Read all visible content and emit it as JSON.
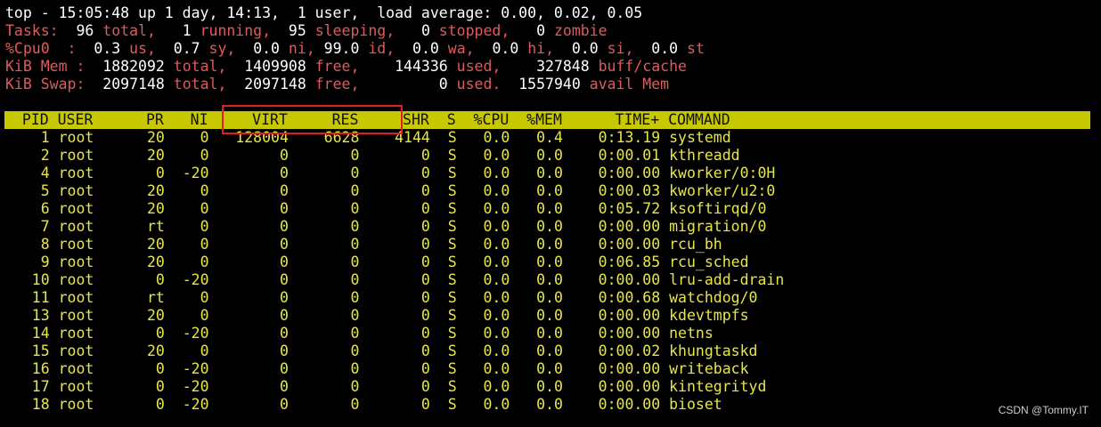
{
  "summary": {
    "line1": "top - 15:05:48 up 1 day, 14:13,  1 user,  load average: 0.00, 0.02, 0.05",
    "tasks": [
      {
        "t": "Tasks: ",
        "c": "lbl"
      },
      {
        "t": " 96",
        "c": "num"
      },
      {
        "t": " total,   ",
        "c": "lbl"
      },
      {
        "t": "1",
        "c": "num"
      },
      {
        "t": " running,  ",
        "c": "lbl"
      },
      {
        "t": "95",
        "c": "num"
      },
      {
        "t": " sleeping,   ",
        "c": "lbl"
      },
      {
        "t": "0",
        "c": "num"
      },
      {
        "t": " stopped,   ",
        "c": "lbl"
      },
      {
        "t": "0",
        "c": "num"
      },
      {
        "t": " zombie",
        "c": "lbl"
      }
    ],
    "cpu": [
      {
        "t": "%Cpu0  : ",
        "c": "lbl"
      },
      {
        "t": " 0.3",
        "c": "num"
      },
      {
        "t": " us,  ",
        "c": "lbl"
      },
      {
        "t": "0.7",
        "c": "num"
      },
      {
        "t": " sy,  ",
        "c": "lbl"
      },
      {
        "t": "0.0",
        "c": "num"
      },
      {
        "t": " ni, ",
        "c": "lbl"
      },
      {
        "t": "99.0",
        "c": "num"
      },
      {
        "t": " id,  ",
        "c": "lbl"
      },
      {
        "t": "0.0",
        "c": "num"
      },
      {
        "t": " wa,  ",
        "c": "lbl"
      },
      {
        "t": "0.0",
        "c": "num"
      },
      {
        "t": " hi,  ",
        "c": "lbl"
      },
      {
        "t": "0.0",
        "c": "num"
      },
      {
        "t": " si,  ",
        "c": "lbl"
      },
      {
        "t": "0.0",
        "c": "num"
      },
      {
        "t": " st",
        "c": "lbl"
      }
    ],
    "mem": [
      {
        "t": "KiB Mem : ",
        "c": "lbl"
      },
      {
        "t": " 1882092",
        "c": "num"
      },
      {
        "t": " total,  ",
        "c": "lbl"
      },
      {
        "t": "1409908",
        "c": "num"
      },
      {
        "t": " free,   ",
        "c": "lbl"
      },
      {
        "t": " 144336",
        "c": "num"
      },
      {
        "t": " used,   ",
        "c": "lbl"
      },
      {
        "t": " 327848",
        "c": "num"
      },
      {
        "t": " buff/cache",
        "c": "lbl"
      }
    ],
    "swap": [
      {
        "t": "KiB Swap: ",
        "c": "lbl"
      },
      {
        "t": " 2097148",
        "c": "num"
      },
      {
        "t": " total,  ",
        "c": "lbl"
      },
      {
        "t": "2097148",
        "c": "num"
      },
      {
        "t": " free,   ",
        "c": "lbl"
      },
      {
        "t": "      0",
        "c": "num"
      },
      {
        "t": " used.  ",
        "c": "lbl"
      },
      {
        "t": "1557940",
        "c": "num"
      },
      {
        "t": " avail Mem",
        "c": "lbl"
      }
    ]
  },
  "columns": [
    "PID",
    "USER",
    "PR",
    "NI",
    "VIRT",
    "RES",
    "SHR",
    "S",
    "%CPU",
    "%MEM",
    "TIME+",
    "COMMAND"
  ],
  "processes": [
    {
      "pid": "1",
      "user": "root",
      "pr": "20",
      "ni": "0",
      "virt": "128004",
      "res": "6628",
      "shr": "4144",
      "s": "S",
      "cpu": "0.0",
      "mem": "0.4",
      "time": "0:13.19",
      "cmd": "systemd"
    },
    {
      "pid": "2",
      "user": "root",
      "pr": "20",
      "ni": "0",
      "virt": "0",
      "res": "0",
      "shr": "0",
      "s": "S",
      "cpu": "0.0",
      "mem": "0.0",
      "time": "0:00.01",
      "cmd": "kthreadd"
    },
    {
      "pid": "4",
      "user": "root",
      "pr": "0",
      "ni": "-20",
      "virt": "0",
      "res": "0",
      "shr": "0",
      "s": "S",
      "cpu": "0.0",
      "mem": "0.0",
      "time": "0:00.00",
      "cmd": "kworker/0:0H"
    },
    {
      "pid": "5",
      "user": "root",
      "pr": "20",
      "ni": "0",
      "virt": "0",
      "res": "0",
      "shr": "0",
      "s": "S",
      "cpu": "0.0",
      "mem": "0.0",
      "time": "0:00.03",
      "cmd": "kworker/u2:0"
    },
    {
      "pid": "6",
      "user": "root",
      "pr": "20",
      "ni": "0",
      "virt": "0",
      "res": "0",
      "shr": "0",
      "s": "S",
      "cpu": "0.0",
      "mem": "0.0",
      "time": "0:05.72",
      "cmd": "ksoftirqd/0"
    },
    {
      "pid": "7",
      "user": "root",
      "pr": "rt",
      "ni": "0",
      "virt": "0",
      "res": "0",
      "shr": "0",
      "s": "S",
      "cpu": "0.0",
      "mem": "0.0",
      "time": "0:00.00",
      "cmd": "migration/0"
    },
    {
      "pid": "8",
      "user": "root",
      "pr": "20",
      "ni": "0",
      "virt": "0",
      "res": "0",
      "shr": "0",
      "s": "S",
      "cpu": "0.0",
      "mem": "0.0",
      "time": "0:00.00",
      "cmd": "rcu_bh"
    },
    {
      "pid": "9",
      "user": "root",
      "pr": "20",
      "ni": "0",
      "virt": "0",
      "res": "0",
      "shr": "0",
      "s": "S",
      "cpu": "0.0",
      "mem": "0.0",
      "time": "0:06.85",
      "cmd": "rcu_sched"
    },
    {
      "pid": "10",
      "user": "root",
      "pr": "0",
      "ni": "-20",
      "virt": "0",
      "res": "0",
      "shr": "0",
      "s": "S",
      "cpu": "0.0",
      "mem": "0.0",
      "time": "0:00.00",
      "cmd": "lru-add-drain"
    },
    {
      "pid": "11",
      "user": "root",
      "pr": "rt",
      "ni": "0",
      "virt": "0",
      "res": "0",
      "shr": "0",
      "s": "S",
      "cpu": "0.0",
      "mem": "0.0",
      "time": "0:00.68",
      "cmd": "watchdog/0"
    },
    {
      "pid": "13",
      "user": "root",
      "pr": "20",
      "ni": "0",
      "virt": "0",
      "res": "0",
      "shr": "0",
      "s": "S",
      "cpu": "0.0",
      "mem": "0.0",
      "time": "0:00.00",
      "cmd": "kdevtmpfs"
    },
    {
      "pid": "14",
      "user": "root",
      "pr": "0",
      "ni": "-20",
      "virt": "0",
      "res": "0",
      "shr": "0",
      "s": "S",
      "cpu": "0.0",
      "mem": "0.0",
      "time": "0:00.00",
      "cmd": "netns"
    },
    {
      "pid": "15",
      "user": "root",
      "pr": "20",
      "ni": "0",
      "virt": "0",
      "res": "0",
      "shr": "0",
      "s": "S",
      "cpu": "0.0",
      "mem": "0.0",
      "time": "0:00.02",
      "cmd": "khungtaskd"
    },
    {
      "pid": "16",
      "user": "root",
      "pr": "0",
      "ni": "-20",
      "virt": "0",
      "res": "0",
      "shr": "0",
      "s": "S",
      "cpu": "0.0",
      "mem": "0.0",
      "time": "0:00.00",
      "cmd": "writeback"
    },
    {
      "pid": "17",
      "user": "root",
      "pr": "0",
      "ni": "-20",
      "virt": "0",
      "res": "0",
      "shr": "0",
      "s": "S",
      "cpu": "0.0",
      "mem": "0.0",
      "time": "0:00.00",
      "cmd": "kintegrityd"
    },
    {
      "pid": "18",
      "user": "root",
      "pr": "0",
      "ni": "-20",
      "virt": "0",
      "res": "0",
      "shr": "0",
      "s": "S",
      "cpu": "0.0",
      "mem": "0.0",
      "time": "0:00.00",
      "cmd": "bioset"
    }
  ],
  "watermark": "CSDN @Tommy.IT",
  "colors": {
    "background": "#000000",
    "label_red": "#e05a5a",
    "header_bar": "#c8c800",
    "process_text": "#e6e64a",
    "highlight_box": "#e02020"
  }
}
